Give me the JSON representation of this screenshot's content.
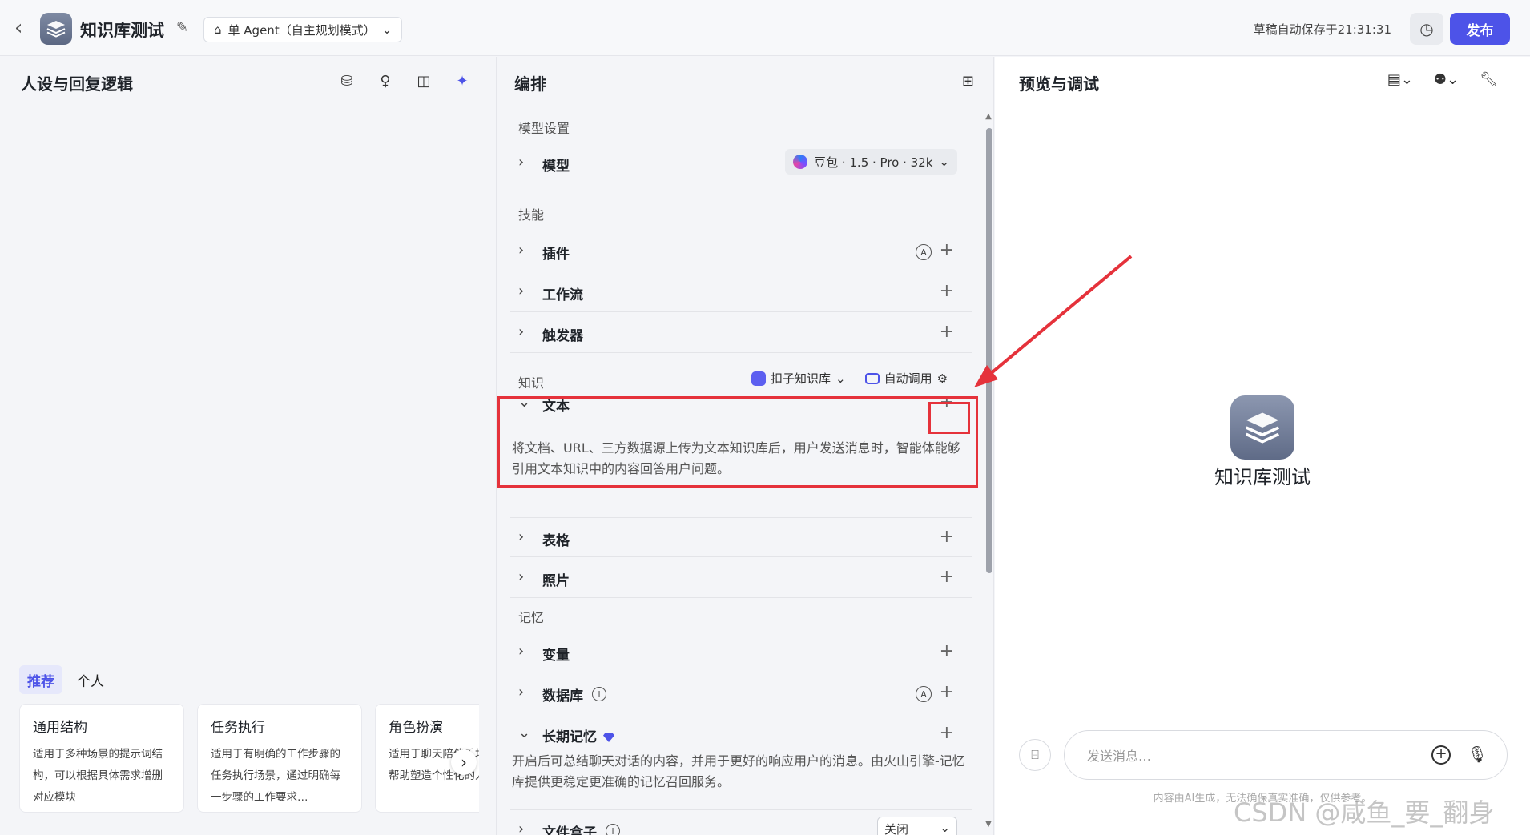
{
  "header": {
    "title": "知识库测试",
    "agent_mode": "单 Agent（自主规划模式）",
    "autosave": "草稿自动保存于21:31:31",
    "publish": "发布"
  },
  "left": {
    "title": "人设与回复逻辑",
    "tabs": [
      "推荐",
      "个人"
    ],
    "cards": [
      {
        "title": "通用结构",
        "desc": "适用于多种场景的提示词结构，可以根据具体需求增删对应模块"
      },
      {
        "title": "任务执行",
        "desc": "适用于有明确的工作步骤的任务执行场景，通过明确每一步骤的工作要求…"
      },
      {
        "title": "角色扮演",
        "desc": "适用于聊天陪伴乐场景，可帮助塑造个性化的人"
      }
    ]
  },
  "middle": {
    "title": "编排",
    "model_section": "模型设置",
    "model_label": "模型",
    "model_value": "豆包 · 1.5 · Pro · 32k",
    "skills_section": "技能",
    "skills": [
      "插件",
      "工作流",
      "触发器"
    ],
    "knowledge_section": "知识",
    "kb_source": "扣子知识库",
    "kb_mode": "自动调用",
    "text_label": "文本",
    "text_desc": "将文档、URL、三方数据源上传为文本知识库后，用户发送消息时，智能体能够引用文本知识中的内容回答用户问题。",
    "table_label": "表格",
    "photo_label": "照片",
    "memory_section": "记忆",
    "variable_label": "变量",
    "database_label": "数据库",
    "ltm_label": "长期记忆",
    "ltm_desc": "开启后可总结聊天对话的内容，并用于更好的响应用户的消息。由火山引擎-记忆库提供更稳定更准确的记忆召回服务。",
    "filebox_label": "文件盒子",
    "filebox_value": "关闭"
  },
  "right": {
    "title": "预览与调试",
    "bot_name": "知识库测试",
    "input_placeholder": "发送消息…",
    "disclaimer": "内容由AI生成，无法确保真实准确，仅供参考。"
  },
  "watermark": "CSDN @咸鱼_要_翻身",
  "colors": {
    "accent": "#4d53e8",
    "annotation": "#e5323b"
  }
}
